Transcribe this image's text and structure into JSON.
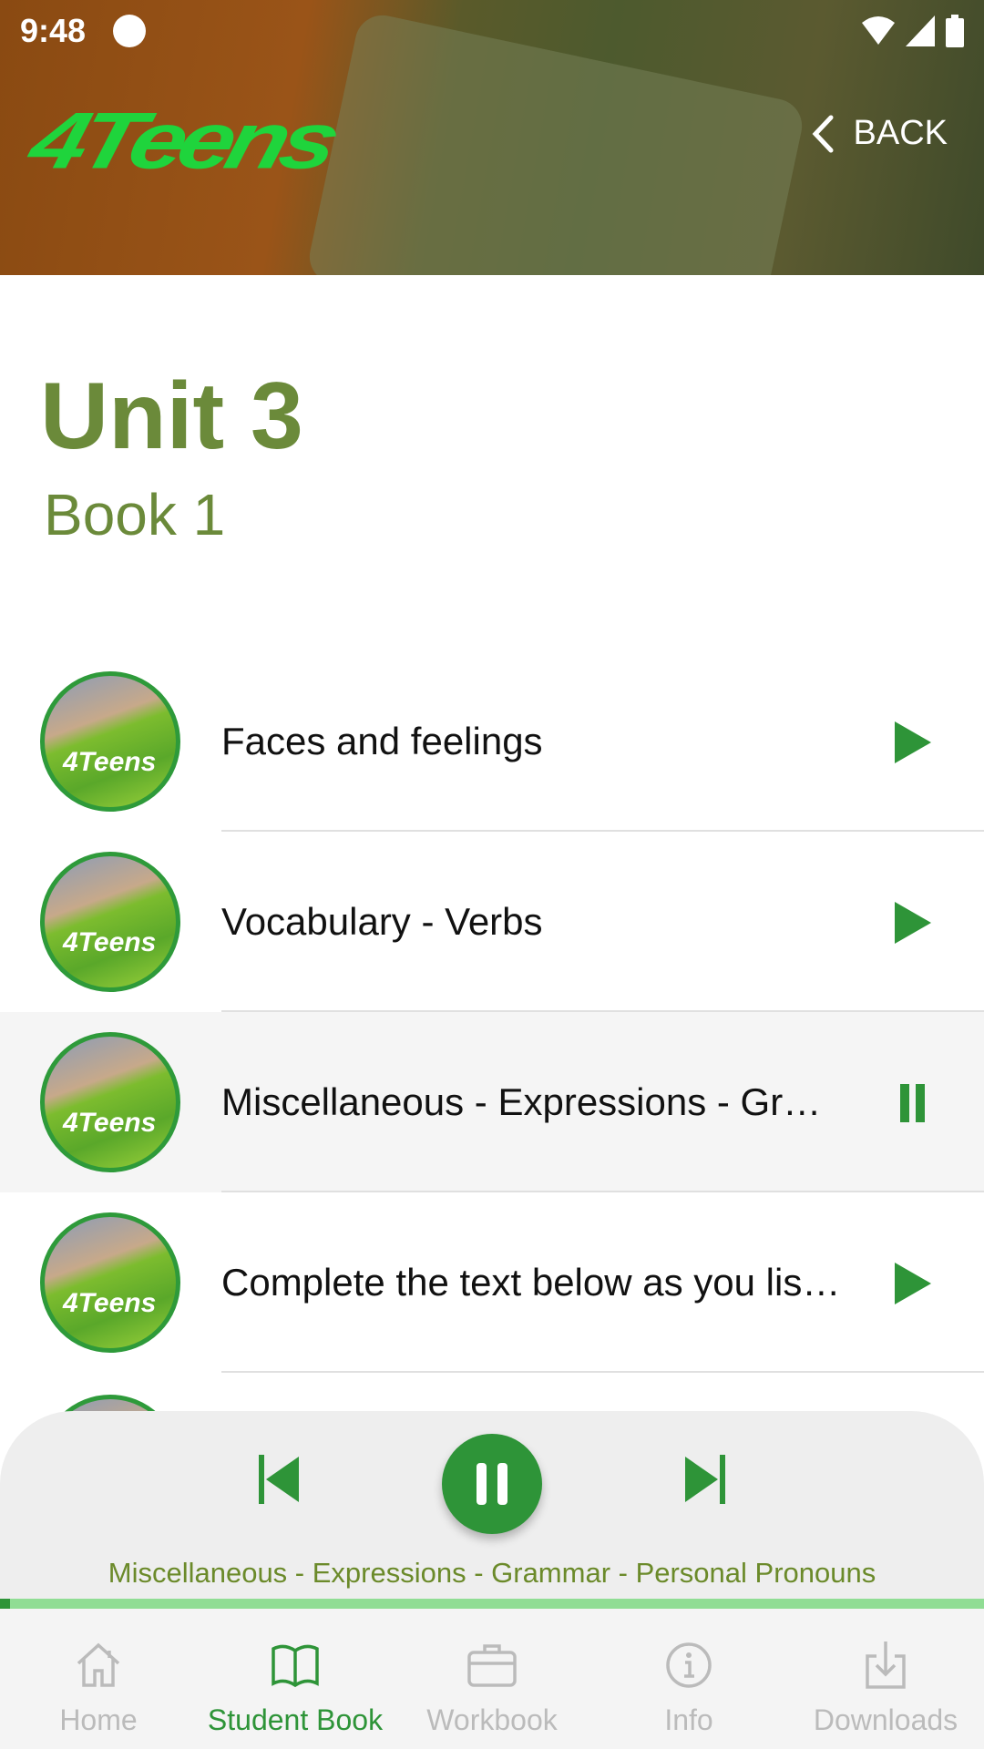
{
  "status": {
    "time": "9:48"
  },
  "header": {
    "logo": "4Teens",
    "back_label": "BACK"
  },
  "page": {
    "title": "Unit 3",
    "subtitle": "Book 1"
  },
  "tracks": [
    {
      "label": "Faces and feelings",
      "state": "play",
      "thumb": "4Teens"
    },
    {
      "label": "Vocabulary - Verbs",
      "state": "play",
      "thumb": "4Teens"
    },
    {
      "label": "Miscellaneous - Expressions - Grammar - Personal Pronouns",
      "state": "pause",
      "thumb": "4Teens"
    },
    {
      "label": "Complete the text below as you listen",
      "state": "play",
      "thumb": "4Teens"
    }
  ],
  "player": {
    "now_playing": "Miscellaneous - Expressions - Grammar - Personal Pronouns",
    "progress_percent": 1,
    "state": "playing"
  },
  "nav": [
    {
      "label": "Home",
      "icon": "home-icon"
    },
    {
      "label": "Student Book",
      "icon": "book-icon",
      "selected": true
    },
    {
      "label": "Workbook",
      "icon": "briefcase-icon"
    },
    {
      "label": "Info",
      "icon": "info-icon"
    },
    {
      "label": "Downloads",
      "icon": "download-icon"
    }
  ],
  "colors": {
    "accent": "#2e9438",
    "title": "#6b8a3a",
    "progress_track": "#90dd94"
  }
}
